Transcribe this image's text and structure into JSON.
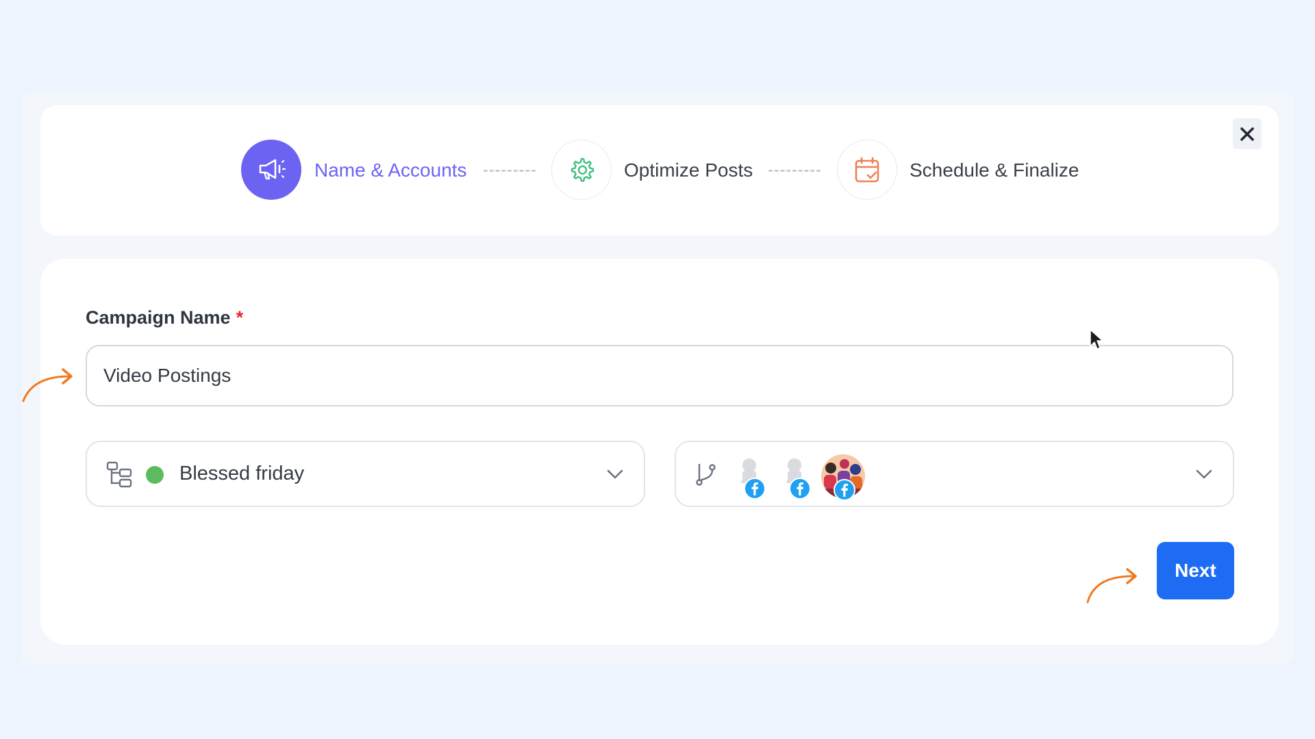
{
  "steps": [
    {
      "label": "Name & Accounts",
      "icon": "megaphone-icon",
      "active": true
    },
    {
      "label": "Optimize Posts",
      "icon": "gear-icon",
      "active": false
    },
    {
      "label": "Schedule & Finalize",
      "icon": "calendar-check-icon",
      "active": false
    }
  ],
  "form": {
    "campaign_label": "Campaign Name",
    "required_marker": "*",
    "campaign_value": "Video Postings",
    "workspace_select": {
      "value": "Blessed friday",
      "status_color": "#5cbb5c"
    },
    "accounts_select": {
      "accounts": [
        {
          "avatar": "default-user",
          "platform": "facebook"
        },
        {
          "avatar": "default-user",
          "platform": "facebook"
        },
        {
          "avatar": "group-photo",
          "platform": "facebook"
        }
      ]
    },
    "next_label": "Next"
  },
  "colors": {
    "accent": "#6c63f3",
    "primary_button": "#1e6cf3",
    "annotation_arrow": "#f07a22",
    "gear_icon": "#3cc07c",
    "calendar_icon": "#f07f55",
    "facebook": "#1fa1f2"
  }
}
